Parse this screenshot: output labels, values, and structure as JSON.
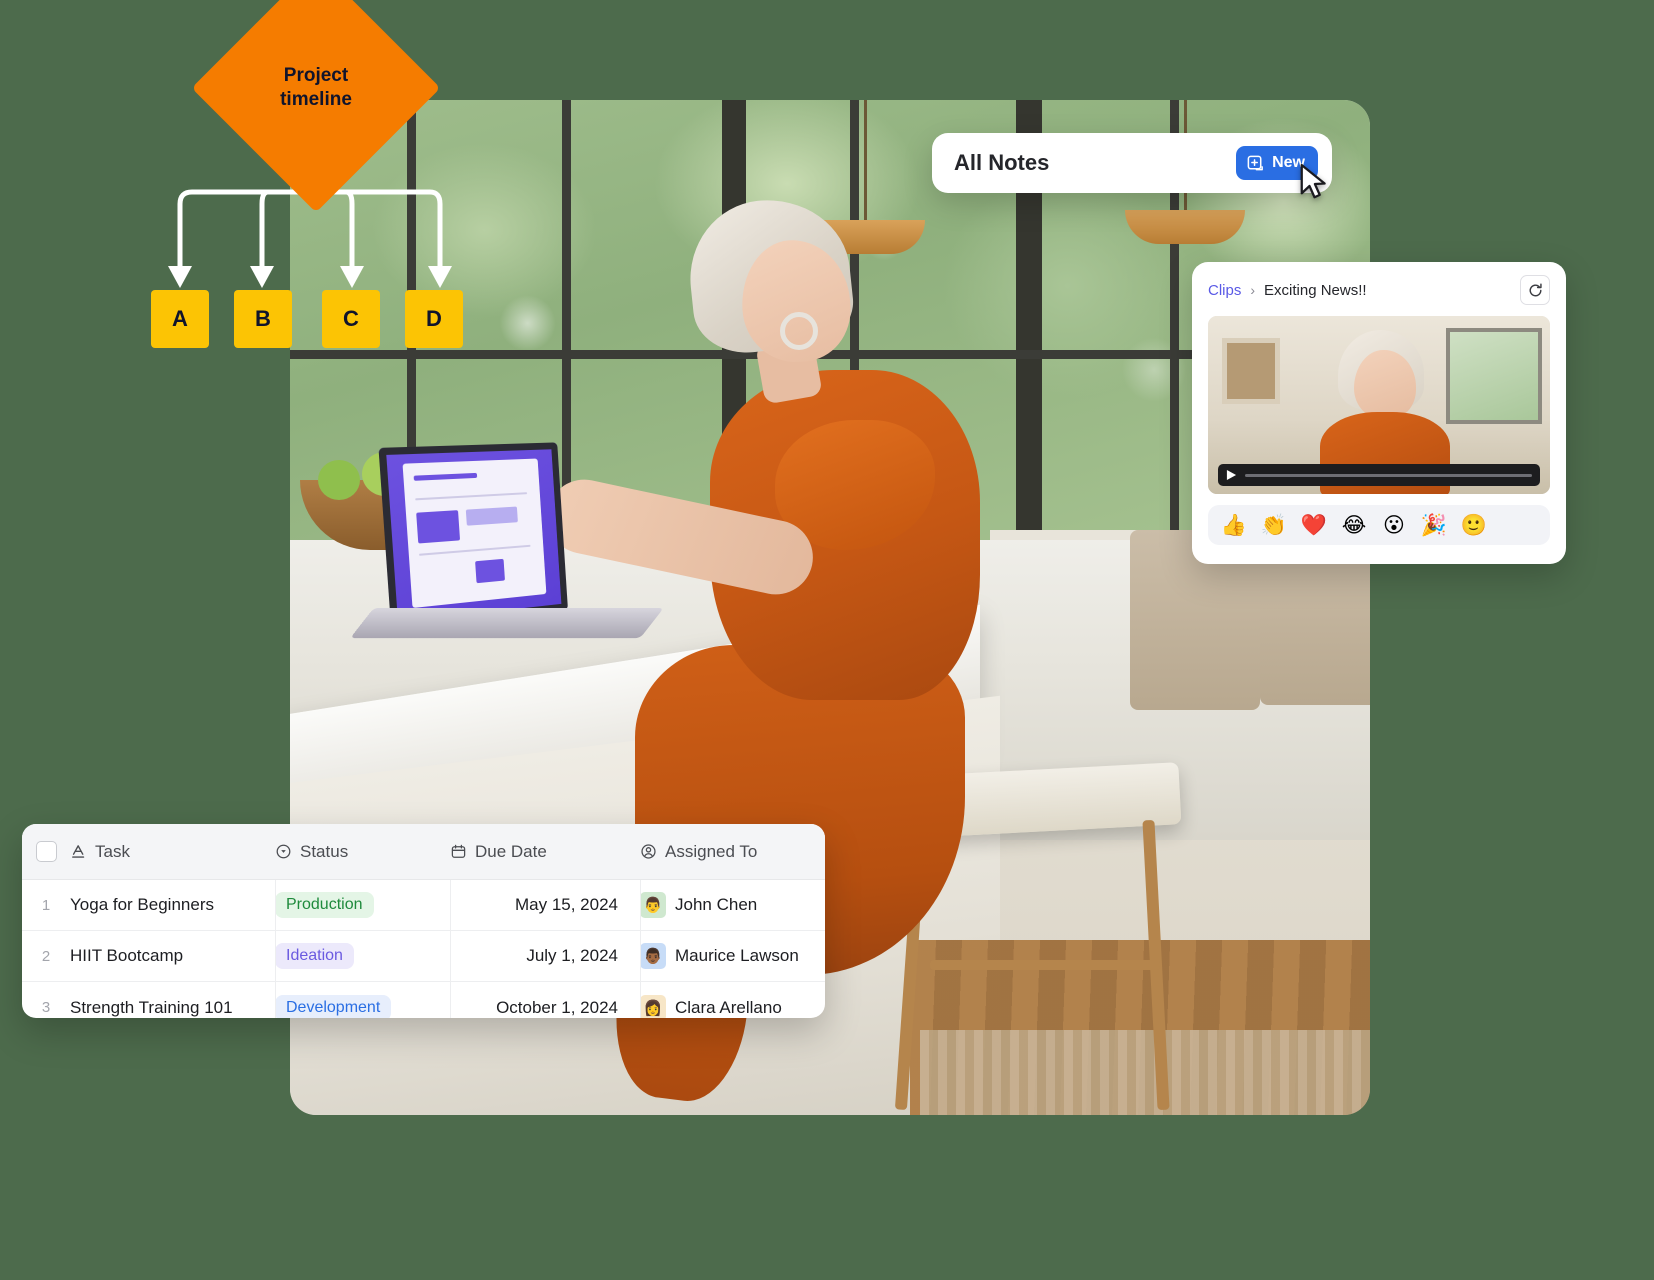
{
  "diagram": {
    "root_label": "Project\ntimeline",
    "root_color": "#f57c00",
    "node_color": "#fcc404",
    "nodes": [
      {
        "label": "A"
      },
      {
        "label": "B"
      },
      {
        "label": "C"
      },
      {
        "label": "D"
      }
    ]
  },
  "notes_card": {
    "title": "All Notes",
    "new_label": "New",
    "new_icon": "new-note-icon",
    "accent": "#2a6ee3",
    "cursor_icon": "cursor-arrow-icon"
  },
  "clips_card": {
    "breadcrumb_root": "Clips",
    "breadcrumb_sep": "›",
    "breadcrumb_current": "Exciting News!!",
    "refresh_icon": "refresh-icon",
    "link_color": "#5a5ae6",
    "video": {
      "play_icon": "play-icon",
      "progress_percent": 0
    },
    "reactions": [
      {
        "name": "thumbs-up-emoji",
        "glyph": "👍"
      },
      {
        "name": "clapping-hands-emoji",
        "glyph": "👏"
      },
      {
        "name": "red-heart-emoji",
        "glyph": "❤️"
      },
      {
        "name": "joy-emoji",
        "glyph": "😂"
      },
      {
        "name": "open-mouth-emoji",
        "glyph": "😮"
      },
      {
        "name": "party-popper-emoji",
        "glyph": "🎉"
      },
      {
        "name": "add-reaction-emoji",
        "glyph": "🙂"
      }
    ]
  },
  "table_card": {
    "columns": [
      {
        "label": "Task",
        "icon": "text-format-icon"
      },
      {
        "label": "Status",
        "icon": "status-circle-icon"
      },
      {
        "label": "Due Date",
        "icon": "calendar-icon"
      },
      {
        "label": "Assigned To",
        "icon": "person-circle-icon"
      }
    ],
    "rows": [
      {
        "number": "1",
        "task": "Yoga for Beginners",
        "status": "Production",
        "status_style": "pill-prod",
        "due_date": "May 15, 2024",
        "assignee": "John Chen",
        "avatar_glyph": "👨",
        "avatar_bg": "#cfe8cf"
      },
      {
        "number": "2",
        "task": "HIIT Bootcamp",
        "status": "Ideation",
        "status_style": "pill-idea",
        "due_date": "July 1, 2024",
        "assignee": "Maurice Lawson",
        "avatar_glyph": "👨🏾",
        "avatar_bg": "#c7dcf7"
      },
      {
        "number": "3",
        "task": "Strength Training 101",
        "status": "Development",
        "status_style": "pill-dev",
        "due_date": "October 1, 2024",
        "assignee": "Clara Arellano",
        "avatar_glyph": "👩",
        "avatar_bg": "#f7e6c7"
      }
    ]
  }
}
